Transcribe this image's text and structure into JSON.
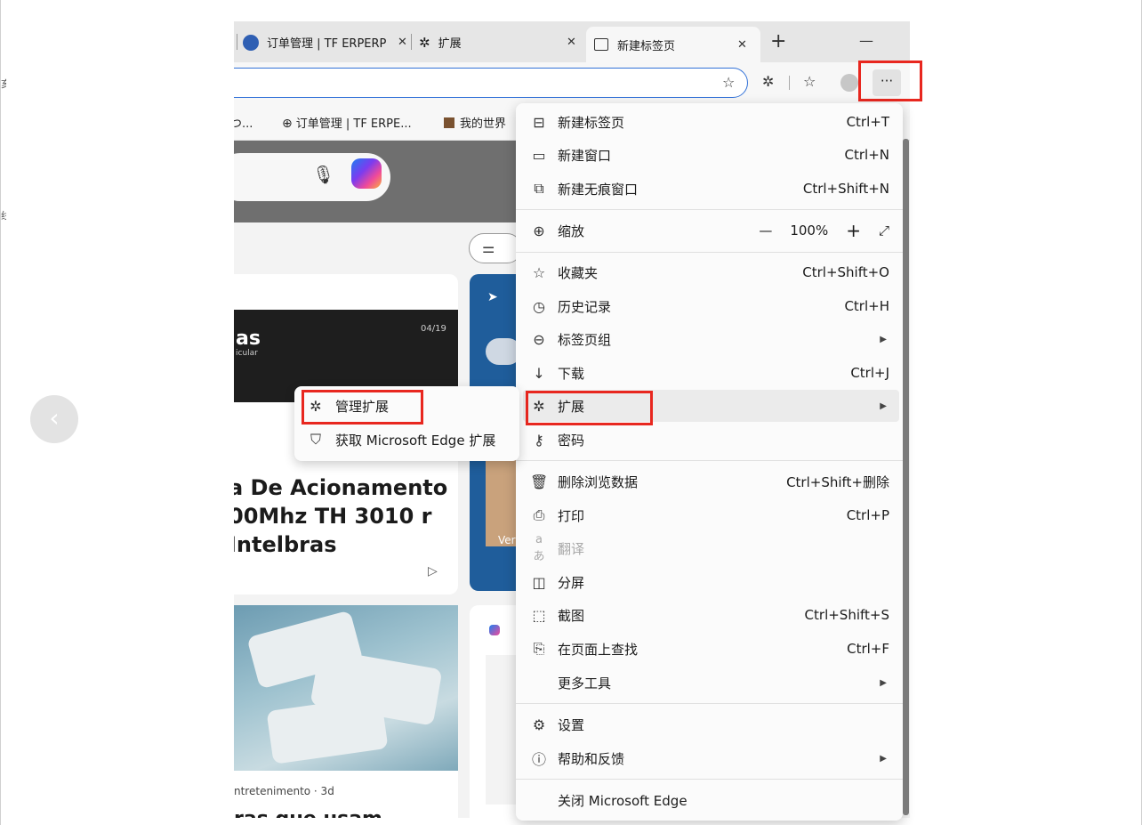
{
  "edge_marks": [
    "亥",
    "线"
  ],
  "tabs": [
    {
      "label": "订单管理 | TF ERPERP"
    },
    {
      "label": "扩展"
    },
    {
      "label": "新建标签页"
    }
  ],
  "toolbar": {
    "new_tab": "+",
    "minimize": "—",
    "more": "···"
  },
  "favorites": [
    {
      "label": "つ..."
    },
    {
      "label": "订单管理 | TF ERPE..."
    },
    {
      "label": "我的世界"
    }
  ],
  "news": {
    "card1_logo": "as",
    "card1_sub": "icular",
    "card1_date": "04/19",
    "card1_title": "a De Acionamento 00Mhz TH 3010 r Intelbras",
    "card2_meta": "ntretenimento · 3d",
    "card2_more": "ras que usam",
    "side_label": "Ver"
  },
  "menu": {
    "new_tab": {
      "label": "新建标签页",
      "shortcut": "Ctrl+T"
    },
    "new_window": {
      "label": "新建窗口",
      "shortcut": "Ctrl+N"
    },
    "new_inprivate": {
      "label": "新建无痕窗口",
      "shortcut": "Ctrl+Shift+N"
    },
    "zoom": {
      "label": "缩放",
      "minus": "—",
      "value": "100%",
      "plus": "+"
    },
    "favorites": {
      "label": "收藏夹",
      "shortcut": "Ctrl+Shift+O"
    },
    "history": {
      "label": "历史记录",
      "shortcut": "Ctrl+H"
    },
    "tab_groups": {
      "label": "标签页组"
    },
    "downloads": {
      "label": "下载",
      "shortcut": "Ctrl+J"
    },
    "extensions": {
      "label": "扩展"
    },
    "passwords": {
      "label": "密码"
    },
    "clear_data": {
      "label": "删除浏览数据",
      "shortcut": "Ctrl+Shift+删除"
    },
    "print": {
      "label": "打印",
      "shortcut": "Ctrl+P"
    },
    "translate": {
      "label": "翻译"
    },
    "split_screen": {
      "label": "分屏"
    },
    "screenshot": {
      "label": "截图",
      "shortcut": "Ctrl+Shift+S"
    },
    "find": {
      "label": "在页面上查找",
      "shortcut": "Ctrl+F"
    },
    "more_tools": {
      "label": "更多工具"
    },
    "settings": {
      "label": "设置"
    },
    "help": {
      "label": "帮助和反馈"
    },
    "close_edge": {
      "label": "关闭 Microsoft Edge"
    }
  },
  "submenu": {
    "manage": {
      "label": "管理扩展"
    },
    "get": {
      "label": "获取 Microsoft Edge 扩展"
    }
  },
  "colors": {
    "highlight": "#e8271f",
    "accent": "#3272d8"
  }
}
